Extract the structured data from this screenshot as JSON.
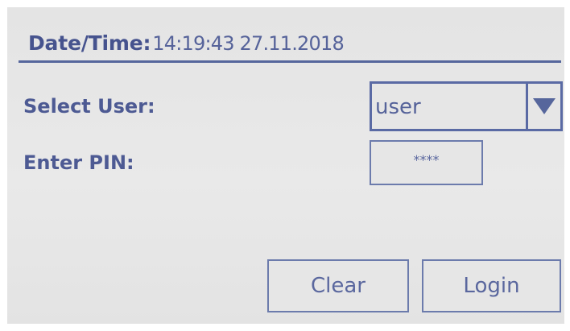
{
  "header": {
    "label": "Date/Time:",
    "value": "14:19:43  27.11.2018"
  },
  "form": {
    "select_user_label": "Select User:",
    "selected_user": "user",
    "dropdown_icon": "triangle-down-icon",
    "enter_pin_label": "Enter PIN:",
    "pin_value": "****"
  },
  "buttons": {
    "clear_label": "Clear",
    "login_label": "Login"
  },
  "colors": {
    "text": "#4a5790",
    "border": "#5a6aa4",
    "background": "#e6e6e6"
  }
}
